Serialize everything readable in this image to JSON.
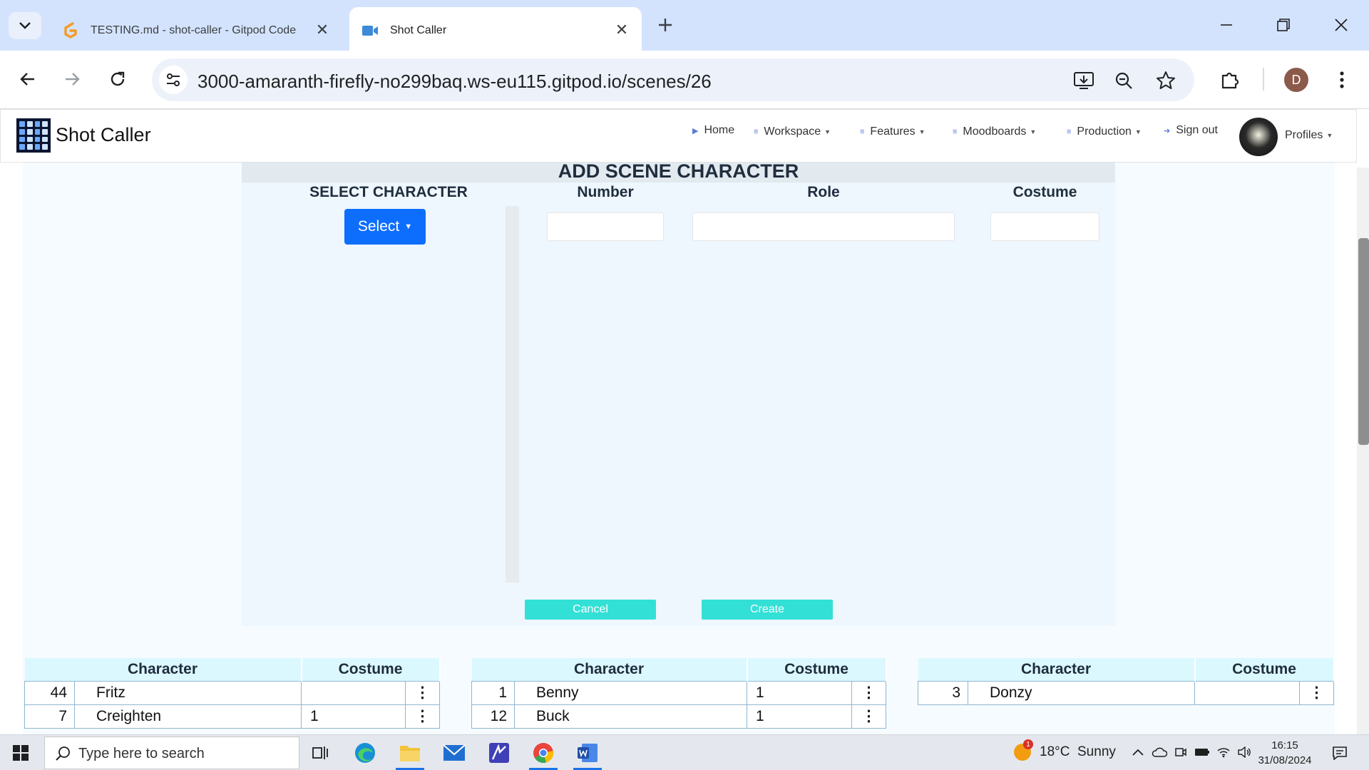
{
  "browser": {
    "tabs": [
      {
        "title": "TESTING.md - shot-caller - Gitpod Code",
        "active": false,
        "favicon": "gitpod-icon"
      },
      {
        "title": "Shot Caller",
        "active": true,
        "favicon": "video-camera-icon"
      }
    ],
    "url": "3000-amaranth-firefly-no299baq.ws-eu115.gitpod.io/scenes/26",
    "profile_initial": "D",
    "accent_color": "#d3e3fd"
  },
  "navbar": {
    "brand": "Shot Caller",
    "items": [
      {
        "label": "Home",
        "dropdown": false,
        "icon": "play-icon"
      },
      {
        "label": "Workspace",
        "dropdown": true,
        "icon": "list-icon"
      },
      {
        "label": "Features",
        "dropdown": true,
        "icon": "list-icon"
      },
      {
        "label": "Moodboards",
        "dropdown": true,
        "icon": "list-icon"
      },
      {
        "label": "Production",
        "dropdown": true,
        "icon": "list-icon"
      },
      {
        "label": "Sign out",
        "dropdown": false,
        "icon": "sign-out-icon"
      }
    ],
    "profiles_label": "Profiles"
  },
  "form": {
    "title": "ADD SCENE CHARACTER",
    "select_character_label": "SELECT CHARACTER",
    "select_button": "Select",
    "number_label": "Number",
    "role_label": "Role",
    "costume_label": "Costume",
    "number_value": "",
    "role_value": "",
    "costume_value": "",
    "cancel_button": "Cancel",
    "create_button": "Create",
    "primary_color": "#0d6efd",
    "action_color": "#33e0d6"
  },
  "tables": [
    {
      "headers": [
        "Character",
        "Costume"
      ],
      "rows": [
        {
          "number": "44",
          "name": "Fritz",
          "costume": ""
        },
        {
          "number": "7",
          "name": "Creighten",
          "costume": "1"
        }
      ]
    },
    {
      "headers": [
        "Character",
        "Costume"
      ],
      "rows": [
        {
          "number": "1",
          "name": "Benny",
          "costume": "1"
        },
        {
          "number": "12",
          "name": "Buck",
          "costume": "1"
        }
      ]
    },
    {
      "headers": [
        "Character",
        "Costume"
      ],
      "rows": [
        {
          "number": "3",
          "name": "Donzy",
          "costume": ""
        }
      ]
    }
  ],
  "row_menu_glyph": "⋮",
  "taskbar": {
    "search_placeholder": "Type here to search",
    "weather": "18°C  Sunny",
    "weather_badge": "1",
    "time": "16:15",
    "date": "31/08/2024"
  }
}
